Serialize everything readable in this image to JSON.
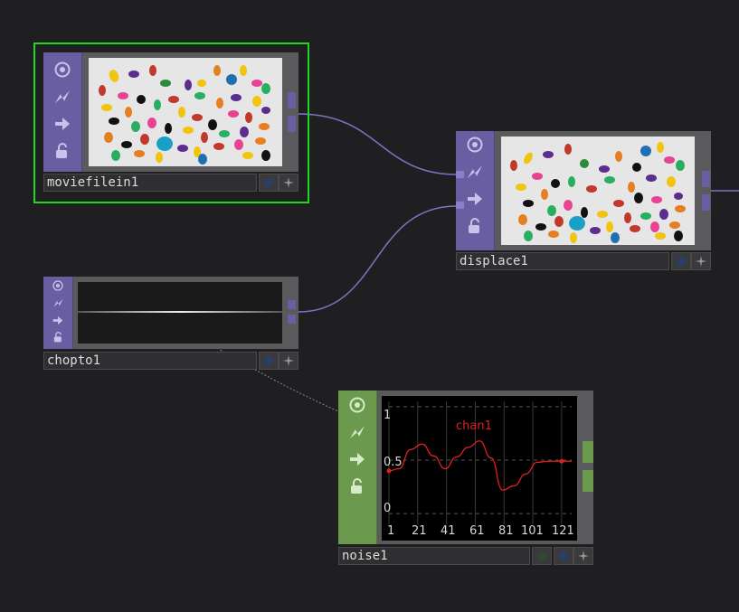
{
  "nodes": {
    "moviefilein": {
      "name": "moviefilein1",
      "selected": true,
      "kind": "TOP"
    },
    "displace": {
      "name": "displace1",
      "kind": "TOP"
    },
    "chopto": {
      "name": "chopto1",
      "kind": "TOP"
    },
    "noise": {
      "name": "noise1",
      "kind": "CHOP",
      "graph": {
        "channel": "chan1",
        "y_ticks": [
          "1",
          "0.5",
          "0"
        ],
        "x_ticks": [
          "1",
          "21",
          "41",
          "61",
          "81",
          "101",
          "121"
        ]
      }
    }
  },
  "chart_data": {
    "type": "line",
    "series": [
      {
        "name": "chan1",
        "x": [
          1,
          8,
          16,
          24,
          32,
          40,
          48,
          56,
          64,
          72,
          80,
          88,
          96,
          104,
          112,
          121,
          128
        ],
        "y": [
          0.4,
          0.42,
          0.6,
          0.65,
          0.54,
          0.42,
          0.53,
          0.62,
          0.68,
          0.52,
          0.22,
          0.26,
          0.37,
          0.48,
          0.49,
          0.49,
          0.49
        ]
      }
    ],
    "ylim": [
      -0.1,
      1.05
    ],
    "x_ticks": [
      "1",
      "21",
      "41",
      "61",
      "81",
      "101",
      "121"
    ],
    "y_ticks": [
      "1",
      "0.5",
      "0"
    ],
    "grid": true
  },
  "colors": {
    "top_operator": "#6a5ea2",
    "chop_operator": "#6b9a4f",
    "selection": "#1ed81e",
    "wire": "#7f73c4",
    "curve": "#e02020"
  },
  "icons": [
    "viewer-icon",
    "bypass-icon",
    "arrow-icon",
    "lock-icon"
  ]
}
